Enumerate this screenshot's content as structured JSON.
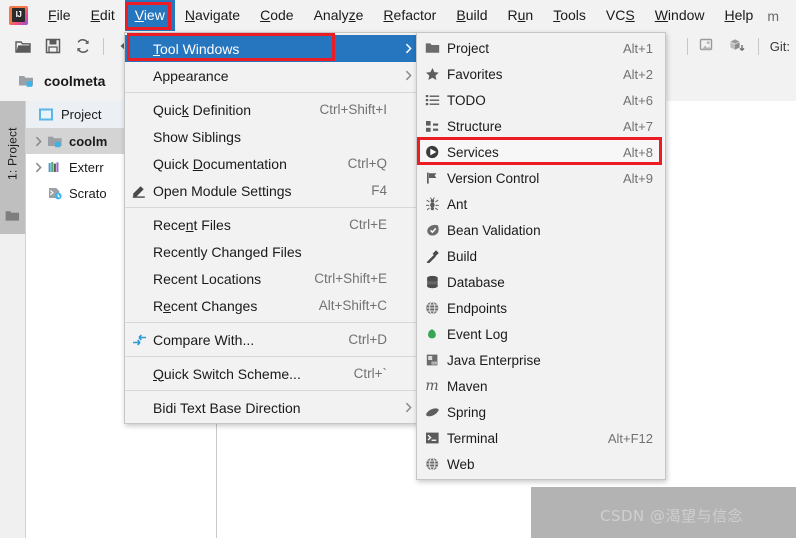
{
  "app": {
    "logo_text": "IJ",
    "project_name": "coolmeta"
  },
  "menubar": {
    "items": [
      {
        "label": "File",
        "mn": "F",
        "active": false
      },
      {
        "label": "Edit",
        "mn": "E",
        "active": false
      },
      {
        "label": "View",
        "mn": "V",
        "active": true
      },
      {
        "label": "Navigate",
        "mn": "N",
        "active": false
      },
      {
        "label": "Code",
        "mn": "C",
        "active": false
      },
      {
        "label": "Analyze",
        "mn": "z",
        "active": false
      },
      {
        "label": "Refactor",
        "mn": "R",
        "active": false
      },
      {
        "label": "Build",
        "mn": "B",
        "active": false
      },
      {
        "label": "Run",
        "mn": "u",
        "active": false
      },
      {
        "label": "Tools",
        "mn": "T",
        "active": false
      },
      {
        "label": "VCS",
        "mn": "S",
        "active": false
      },
      {
        "label": "Window",
        "mn": "W",
        "active": false
      },
      {
        "label": "Help",
        "mn": "H",
        "active": false
      }
    ],
    "overflow_label": "m"
  },
  "toolbar": {
    "icons": [
      "open-folder-icon",
      "save-icon",
      "sync-icon",
      "back-arrow-icon",
      "run-config-icon",
      "build-module-icon"
    ],
    "git_label": "Git:"
  },
  "project_header": {
    "name": "coolmeta",
    "icon": "module-folder-icon"
  },
  "side_strip": {
    "tab_label": "1: Project",
    "tab_icon": "folder-icon"
  },
  "project_panel": {
    "tab_label": "Project",
    "tab_icon": "project-view-icon",
    "tree": [
      {
        "label": "coolm",
        "icon": "module-folder-icon",
        "arrow": "collapsed",
        "selected": true
      },
      {
        "label": "Exterr",
        "icon": "external-libraries-icon",
        "arrow": "collapsed",
        "selected": false
      },
      {
        "label": "Scrato",
        "icon": "scratches-icon",
        "arrow": "none",
        "selected": false
      }
    ]
  },
  "view_menu": {
    "rows": [
      {
        "type": "item",
        "label": "Tool Windows",
        "mn": "T",
        "accel": "",
        "icon": "",
        "arrow": true,
        "state": "selected"
      },
      {
        "type": "item",
        "label": "Appearance",
        "mn": "",
        "accel": "",
        "icon": "",
        "arrow": true,
        "state": "normal"
      },
      {
        "type": "sep"
      },
      {
        "type": "item",
        "label": "Quick Definition",
        "mn": "k",
        "accel": "Ctrl+Shift+I",
        "icon": "",
        "arrow": false,
        "state": "normal"
      },
      {
        "type": "item",
        "label": "Show Siblings",
        "mn": "",
        "accel": "",
        "icon": "",
        "arrow": false,
        "state": "normal"
      },
      {
        "type": "item",
        "label": "Quick Documentation",
        "mn": "D",
        "accel": "Ctrl+Q",
        "icon": "",
        "arrow": false,
        "state": "normal"
      },
      {
        "type": "item",
        "label": "Open Module Settings",
        "mn": "",
        "accel": "F4",
        "icon": "edit-pencil-icon",
        "arrow": false,
        "state": "normal"
      },
      {
        "type": "sep"
      },
      {
        "type": "item",
        "label": "Recent Files",
        "mn": "n",
        "accel": "Ctrl+E",
        "icon": "",
        "arrow": false,
        "state": "normal"
      },
      {
        "type": "item",
        "label": "Recently Changed Files",
        "mn": "",
        "accel": "",
        "icon": "",
        "arrow": false,
        "state": "normal"
      },
      {
        "type": "item",
        "label": "Recent Locations",
        "mn": "",
        "accel": "Ctrl+Shift+E",
        "icon": "",
        "arrow": false,
        "state": "normal"
      },
      {
        "type": "item",
        "label": "Recent Changes",
        "mn": "e",
        "accel": "Alt+Shift+C",
        "icon": "",
        "arrow": false,
        "state": "normal"
      },
      {
        "type": "sep"
      },
      {
        "type": "item",
        "label": "Compare With...",
        "mn": "",
        "accel": "Ctrl+D",
        "icon": "compare-icon",
        "arrow": false,
        "state": "normal"
      },
      {
        "type": "sep"
      },
      {
        "type": "item",
        "label": "Quick Switch Scheme...",
        "mn": "Q",
        "accel": "Ctrl+`",
        "icon": "",
        "arrow": false,
        "state": "normal"
      },
      {
        "type": "sep"
      },
      {
        "type": "item",
        "label": "Bidi Text Base Direction",
        "mn": "",
        "accel": "",
        "icon": "",
        "arrow": true,
        "state": "normal"
      }
    ]
  },
  "tool_windows_submenu": {
    "rows": [
      {
        "label": "Project",
        "accel": "Alt+1",
        "icon": "project-folder-icon",
        "state": "normal"
      },
      {
        "label": "Favorites",
        "accel": "Alt+2",
        "icon": "star-icon",
        "state": "normal"
      },
      {
        "label": "TODO",
        "accel": "Alt+6",
        "icon": "todo-list-icon",
        "state": "normal"
      },
      {
        "label": "Structure",
        "accel": "Alt+7",
        "icon": "structure-icon",
        "state": "normal"
      },
      {
        "label": "Services",
        "accel": "Alt+8",
        "icon": "services-play-icon",
        "state": "hover"
      },
      {
        "label": "Version Control",
        "accel": "Alt+9",
        "icon": "version-control-icon",
        "state": "normal"
      },
      {
        "label": "Ant",
        "accel": "",
        "icon": "ant-icon",
        "state": "normal"
      },
      {
        "label": "Bean Validation",
        "accel": "",
        "icon": "bean-validation-icon",
        "state": "normal"
      },
      {
        "label": "Build",
        "accel": "",
        "icon": "build-hammer-icon",
        "state": "normal"
      },
      {
        "label": "Database",
        "accel": "",
        "icon": "database-icon",
        "state": "normal"
      },
      {
        "label": "Endpoints",
        "accel": "",
        "icon": "endpoints-globe-icon",
        "state": "normal"
      },
      {
        "label": "Event Log",
        "accel": "",
        "icon": "event-log-icon",
        "state": "normal"
      },
      {
        "label": "Java Enterprise",
        "accel": "",
        "icon": "java-enterprise-icon",
        "state": "normal"
      },
      {
        "label": "Maven",
        "accel": "",
        "icon": "maven-icon",
        "state": "normal"
      },
      {
        "label": "Spring",
        "accel": "",
        "icon": "spring-leaf-icon",
        "state": "normal"
      },
      {
        "label": "Terminal",
        "accel": "Alt+F12",
        "icon": "terminal-icon",
        "state": "normal"
      },
      {
        "label": "Web",
        "accel": "",
        "icon": "web-globe-icon",
        "state": "normal"
      }
    ]
  },
  "watermark": {
    "text": "CSDN @渴望与信念"
  },
  "colors": {
    "accent_blue": "#2675bf",
    "annotation_red": "#ec1c24",
    "menu_bg": "#f2f2f2",
    "selection_grey": "#d4d4d4"
  }
}
